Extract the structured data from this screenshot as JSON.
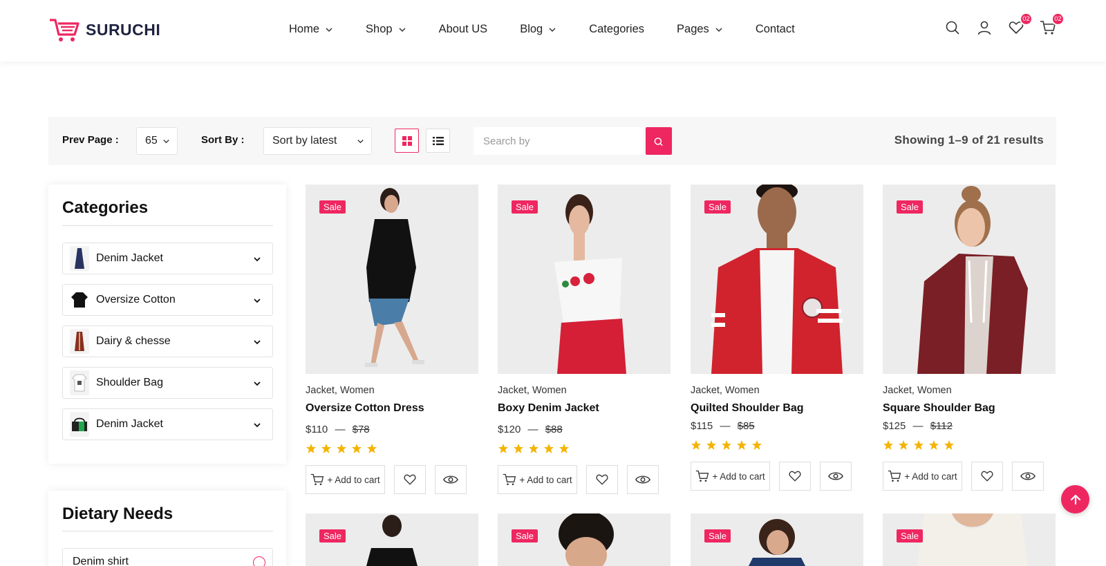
{
  "brand": {
    "name": "SURUCHI",
    "accent": "#ee2761"
  },
  "nav": [
    {
      "label": "Home",
      "dropdown": true
    },
    {
      "label": "Shop",
      "dropdown": true
    },
    {
      "label": "About US",
      "dropdown": false
    },
    {
      "label": "Blog",
      "dropdown": true
    },
    {
      "label": "Categories",
      "dropdown": false
    },
    {
      "label": "Pages",
      "dropdown": true
    },
    {
      "label": "Contact",
      "dropdown": false
    }
  ],
  "header_icons": {
    "wishlist_count": "02",
    "cart_count": "02"
  },
  "toolbar": {
    "prev_page_label": "Prev Page :",
    "prev_page_value": "65",
    "sort_label": "Sort By :",
    "sort_value": "Sort by latest",
    "search_placeholder": "Search by",
    "results_text": "Showing 1–9 of 21 results"
  },
  "sidebar": {
    "categories_title": "Categories",
    "categories": [
      {
        "label": "Denim Jacket",
        "icon": "dress-thumb"
      },
      {
        "label": "Oversize Cotton",
        "icon": "shirt-thumb"
      },
      {
        "label": "Dairy & chesse",
        "icon": "coat-thumb"
      },
      {
        "label": "Shoulder Bag",
        "icon": "tshirt-thumb"
      },
      {
        "label": "Denim Jacket",
        "icon": "bag-thumb"
      }
    ],
    "dietary_title": "Dietary Needs",
    "dietary": [
      {
        "label": "Denim shirt"
      }
    ]
  },
  "products": [
    {
      "category": "Jacket, Women",
      "name": "Oversize Cotton Dress",
      "price": "$110",
      "old_price": "$78",
      "rating": 5,
      "badge": "Sale",
      "image": "woman-black-top-denim-shorts"
    },
    {
      "category": "Jacket, Women",
      "name": "Boxy Denim Jacket",
      "price": "$120",
      "old_price": "$88",
      "rating": 5,
      "badge": "Sale",
      "image": "woman-white-crop-red-jeans"
    },
    {
      "category": "Jacket, Women",
      "name": "Quilted Shoulder Bag",
      "price": "$115",
      "old_price": "$85",
      "rating": 5,
      "badge": "Sale",
      "image": "man-red-varsity-jacket"
    },
    {
      "category": "Jacket, Women",
      "name": "Square Shoulder Bag",
      "price": "$125",
      "old_price": "$112",
      "rating": 5,
      "badge": "Sale",
      "image": "woman-maroon-hoodie"
    }
  ],
  "second_row": [
    {
      "badge": "Sale"
    },
    {
      "badge": "Sale"
    },
    {
      "badge": "Sale"
    },
    {
      "badge": "Sale"
    }
  ],
  "labels": {
    "add_to_cart": "+ Add to cart",
    "price_sep": "—"
  }
}
